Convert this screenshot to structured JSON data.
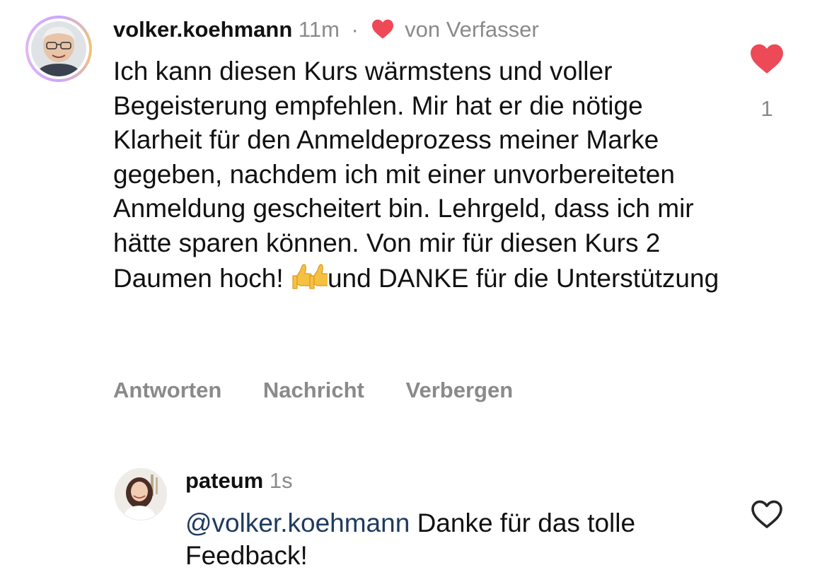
{
  "comment": {
    "username": "volker.koehmann",
    "time": "11m",
    "separator": "·",
    "by_author_label": "von Verfasser",
    "text_part1": "Ich kann diesen Kurs wärmstens und voller Begeisterung empfehlen. Mir hat er die nötige Klarheit für den Anmeldeprozess meiner Marke gegeben, nachdem ich mit einer unvorbereiteten Anmeldung gescheitert bin. Lehrgeld, dass ich mir hätte sparen können. Von mir für diesen Kurs 2 Daumen hoch! ",
    "emoji": "thumbs-up-icon ×2",
    "text_part2": "und DANKE für die Unterstützung",
    "like_count": "1",
    "like_icon": "heart-filled-icon",
    "like_color": "#ed4956",
    "actions": {
      "reply": "Antworten",
      "message": "Nachricht",
      "hide": "Verbergen"
    }
  },
  "reply": {
    "username": "pateum",
    "time": "1s",
    "mention": "@volker.koehmann",
    "text": " Danke für das tolle Feedback!",
    "like_icon": "heart-outline-icon"
  },
  "colors": {
    "secondary_text": "#8a8a8a",
    "primary_text": "#111111",
    "mention": "#1e3a5f",
    "heart": "#ed4956"
  }
}
